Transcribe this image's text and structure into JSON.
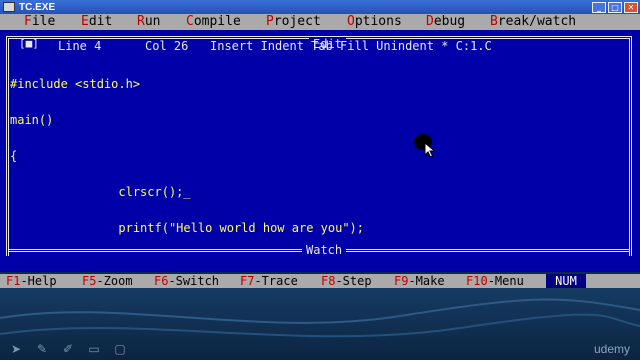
{
  "window": {
    "title": "TC.EXE",
    "minimize_glyph": "_",
    "maximize_glyph": "□",
    "close_glyph": "✕"
  },
  "menu": {
    "items": [
      {
        "hot": "F",
        "rest": "ile"
      },
      {
        "hot": "E",
        "rest": "dit"
      },
      {
        "hot": "R",
        "rest": "un"
      },
      {
        "hot": "C",
        "rest": "ompile"
      },
      {
        "hot": "P",
        "rest": "roject"
      },
      {
        "hot": "O",
        "rest": "ptions"
      },
      {
        "hot": "D",
        "rest": "ebug"
      },
      {
        "hot": "B",
        "rest": "reak/watch"
      }
    ]
  },
  "editor": {
    "title": "Edit",
    "close_box": "[■]",
    "status": {
      "line": "Line 4",
      "col": "Col 26",
      "modes": "Insert Indent Tab Fill Unindent * C:1.C"
    },
    "code_lines": [
      "#include <stdio.h>",
      "main()",
      "{",
      "               clrscr();_",
      "               printf(\"Hello world how are you\");",
      "}"
    ]
  },
  "watch": {
    "title": "Watch"
  },
  "fkeys": [
    {
      "key": "F1",
      "label": "-Help"
    },
    {
      "key": "F5",
      "label": "-Zoom"
    },
    {
      "key": "F6",
      "label": "-Switch"
    },
    {
      "key": "F7",
      "label": "-Trace"
    },
    {
      "key": "F8",
      "label": "-Step"
    },
    {
      "key": "F9",
      "label": "-Make"
    },
    {
      "key": "F10",
      "label": "-Menu"
    }
  ],
  "num_indicator": "NUM",
  "player": {
    "tool_icons": [
      "pointer-icon",
      "pencil-icon",
      "pen-icon",
      "eraser-icon",
      "comment-icon"
    ],
    "brand": "udemy"
  }
}
